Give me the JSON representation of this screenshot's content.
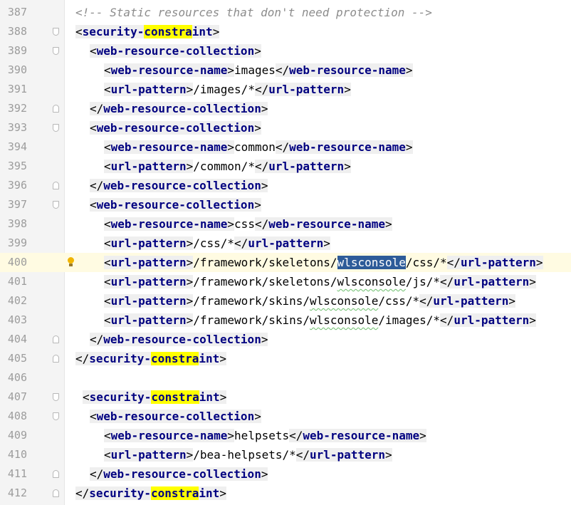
{
  "editor": {
    "lines": [
      {
        "n": "387",
        "ind": 0,
        "parts": [
          {
            "t": "<!-- Static resources that don't need protection -->",
            "c": "comment"
          }
        ]
      },
      {
        "n": "388",
        "ind": 0,
        "fold": "start",
        "parts": [
          {
            "t": "<",
            "c": "b"
          },
          {
            "t": "security-",
            "c": "tag"
          },
          {
            "t": "constra",
            "c": "taghl"
          },
          {
            "t": "int",
            "c": "tag"
          },
          {
            "t": ">",
            "c": "b"
          }
        ]
      },
      {
        "n": "389",
        "ind": 2,
        "fold": "start",
        "parts": [
          {
            "t": "<",
            "c": "b"
          },
          {
            "t": "web-resource-collection",
            "c": "tag"
          },
          {
            "t": ">",
            "c": "b"
          }
        ]
      },
      {
        "n": "390",
        "ind": 4,
        "parts": [
          {
            "t": "<",
            "c": "b"
          },
          {
            "t": "web-resource-name",
            "c": "tag"
          },
          {
            "t": ">",
            "c": "b"
          },
          {
            "t": "images",
            "c": "txt"
          },
          {
            "t": "</",
            "c": "b"
          },
          {
            "t": "web-resource-name",
            "c": "tag"
          },
          {
            "t": ">",
            "c": "b"
          }
        ]
      },
      {
        "n": "391",
        "ind": 4,
        "parts": [
          {
            "t": "<",
            "c": "b"
          },
          {
            "t": "url-pattern",
            "c": "tag"
          },
          {
            "t": ">",
            "c": "b"
          },
          {
            "t": "/images/*",
            "c": "txt"
          },
          {
            "t": "</",
            "c": "b"
          },
          {
            "t": "url-pattern",
            "c": "tag"
          },
          {
            "t": ">",
            "c": "b"
          }
        ]
      },
      {
        "n": "392",
        "ind": 2,
        "fold": "end",
        "parts": [
          {
            "t": "</",
            "c": "b"
          },
          {
            "t": "web-resource-collection",
            "c": "tag"
          },
          {
            "t": ">",
            "c": "b"
          }
        ]
      },
      {
        "n": "393",
        "ind": 2,
        "fold": "start",
        "parts": [
          {
            "t": "<",
            "c": "b"
          },
          {
            "t": "web-resource-collection",
            "c": "tag"
          },
          {
            "t": ">",
            "c": "b"
          }
        ]
      },
      {
        "n": "394",
        "ind": 4,
        "parts": [
          {
            "t": "<",
            "c": "b"
          },
          {
            "t": "web-resource-name",
            "c": "tag"
          },
          {
            "t": ">",
            "c": "b"
          },
          {
            "t": "common",
            "c": "txt"
          },
          {
            "t": "</",
            "c": "b"
          },
          {
            "t": "web-resource-name",
            "c": "tag"
          },
          {
            "t": ">",
            "c": "b"
          }
        ]
      },
      {
        "n": "395",
        "ind": 4,
        "parts": [
          {
            "t": "<",
            "c": "b"
          },
          {
            "t": "url-pattern",
            "c": "tag"
          },
          {
            "t": ">",
            "c": "b"
          },
          {
            "t": "/common/*",
            "c": "txt"
          },
          {
            "t": "</",
            "c": "b"
          },
          {
            "t": "url-pattern",
            "c": "tag"
          },
          {
            "t": ">",
            "c": "b"
          }
        ]
      },
      {
        "n": "396",
        "ind": 2,
        "fold": "end",
        "parts": [
          {
            "t": "</",
            "c": "b"
          },
          {
            "t": "web-resource-collection",
            "c": "tag"
          },
          {
            "t": ">",
            "c": "b"
          }
        ]
      },
      {
        "n": "397",
        "ind": 2,
        "fold": "start",
        "parts": [
          {
            "t": "<",
            "c": "b"
          },
          {
            "t": "web-resource-collection",
            "c": "tag"
          },
          {
            "t": ">",
            "c": "b"
          }
        ]
      },
      {
        "n": "398",
        "ind": 4,
        "parts": [
          {
            "t": "<",
            "c": "b"
          },
          {
            "t": "web-resource-name",
            "c": "tag"
          },
          {
            "t": ">",
            "c": "b"
          },
          {
            "t": "css",
            "c": "txt"
          },
          {
            "t": "</",
            "c": "b"
          },
          {
            "t": "web-resource-name",
            "c": "tag"
          },
          {
            "t": ">",
            "c": "b"
          }
        ]
      },
      {
        "n": "399",
        "ind": 4,
        "parts": [
          {
            "t": "<",
            "c": "b"
          },
          {
            "t": "url-pattern",
            "c": "tag"
          },
          {
            "t": ">",
            "c": "b"
          },
          {
            "t": "/css/*",
            "c": "txt"
          },
          {
            "t": "</",
            "c": "b"
          },
          {
            "t": "url-pattern",
            "c": "tag"
          },
          {
            "t": ">",
            "c": "b"
          }
        ]
      },
      {
        "n": "400",
        "ind": 4,
        "current": true,
        "bulb": true,
        "parts": [
          {
            "t": "<",
            "c": "b"
          },
          {
            "t": "url-pattern",
            "c": "tag"
          },
          {
            "t": ">",
            "c": "b"
          },
          {
            "t": "/framework/skeletons/",
            "c": "txt"
          },
          {
            "t": "wlsconsole",
            "c": "sel"
          },
          {
            "t": "/css/*",
            "c": "txt"
          },
          {
            "t": "</",
            "c": "b"
          },
          {
            "t": "url-pattern",
            "c": "tag"
          },
          {
            "t": ">",
            "c": "b"
          }
        ]
      },
      {
        "n": "401",
        "ind": 4,
        "parts": [
          {
            "t": "<",
            "c": "b"
          },
          {
            "t": "url-pattern",
            "c": "tag"
          },
          {
            "t": ">",
            "c": "b"
          },
          {
            "t": "/framework/skeletons/",
            "c": "txt"
          },
          {
            "t": "wlsconsole",
            "c": "sq"
          },
          {
            "t": "/js/*",
            "c": "txt"
          },
          {
            "t": "</",
            "c": "b"
          },
          {
            "t": "url-pattern",
            "c": "tag"
          },
          {
            "t": ">",
            "c": "b"
          }
        ]
      },
      {
        "n": "402",
        "ind": 4,
        "parts": [
          {
            "t": "<",
            "c": "b"
          },
          {
            "t": "url-pattern",
            "c": "tag"
          },
          {
            "t": ">",
            "c": "b"
          },
          {
            "t": "/framework/skins/",
            "c": "txt"
          },
          {
            "t": "wlsconsole",
            "c": "sq"
          },
          {
            "t": "/css/*",
            "c": "txt"
          },
          {
            "t": "</",
            "c": "b"
          },
          {
            "t": "url-pattern",
            "c": "tag"
          },
          {
            "t": ">",
            "c": "b"
          }
        ]
      },
      {
        "n": "403",
        "ind": 4,
        "parts": [
          {
            "t": "<",
            "c": "b"
          },
          {
            "t": "url-pattern",
            "c": "tag"
          },
          {
            "t": ">",
            "c": "b"
          },
          {
            "t": "/framework/skins/",
            "c": "txt"
          },
          {
            "t": "wlsconsole",
            "c": "sq"
          },
          {
            "t": "/images/*",
            "c": "txt"
          },
          {
            "t": "</",
            "c": "b"
          },
          {
            "t": "url-pattern",
            "c": "tag"
          },
          {
            "t": ">",
            "c": "b"
          }
        ]
      },
      {
        "n": "404",
        "ind": 2,
        "fold": "end",
        "parts": [
          {
            "t": "</",
            "c": "b"
          },
          {
            "t": "web-resource-collection",
            "c": "tag"
          },
          {
            "t": ">",
            "c": "b"
          }
        ]
      },
      {
        "n": "405",
        "ind": 0,
        "fold": "end",
        "parts": [
          {
            "t": "</",
            "c": "b"
          },
          {
            "t": "security-",
            "c": "tag"
          },
          {
            "t": "constra",
            "c": "taghl"
          },
          {
            "t": "int",
            "c": "tag"
          },
          {
            "t": ">",
            "c": "b"
          }
        ]
      },
      {
        "n": "406",
        "ind": 0,
        "parts": []
      },
      {
        "n": "407",
        "ind": 1,
        "fold": "start",
        "parts": [
          {
            "t": "<",
            "c": "b"
          },
          {
            "t": "security-",
            "c": "tag"
          },
          {
            "t": "constra",
            "c": "taghl"
          },
          {
            "t": "int",
            "c": "tag"
          },
          {
            "t": ">",
            "c": "b"
          }
        ]
      },
      {
        "n": "408",
        "ind": 2,
        "fold": "start",
        "parts": [
          {
            "t": "<",
            "c": "b"
          },
          {
            "t": "web-resource-collection",
            "c": "tag"
          },
          {
            "t": ">",
            "c": "b"
          }
        ]
      },
      {
        "n": "409",
        "ind": 4,
        "parts": [
          {
            "t": "<",
            "c": "b"
          },
          {
            "t": "web-resource-name",
            "c": "tag"
          },
          {
            "t": ">",
            "c": "b"
          },
          {
            "t": "helpsets",
            "c": "txt"
          },
          {
            "t": "</",
            "c": "b"
          },
          {
            "t": "web-resource-name",
            "c": "tag"
          },
          {
            "t": ">",
            "c": "b"
          }
        ]
      },
      {
        "n": "410",
        "ind": 4,
        "parts": [
          {
            "t": "<",
            "c": "b"
          },
          {
            "t": "url-pattern",
            "c": "tag"
          },
          {
            "t": ">",
            "c": "b"
          },
          {
            "t": "/bea-helpsets/*",
            "c": "txt"
          },
          {
            "t": "</",
            "c": "b"
          },
          {
            "t": "url-pattern",
            "c": "tag"
          },
          {
            "t": ">",
            "c": "b"
          }
        ]
      },
      {
        "n": "411",
        "ind": 2,
        "fold": "end",
        "parts": [
          {
            "t": "</",
            "c": "b"
          },
          {
            "t": "web-resource-collection",
            "c": "tag"
          },
          {
            "t": ">",
            "c": "b"
          }
        ]
      },
      {
        "n": "412",
        "ind": 0,
        "fold": "end",
        "parts": [
          {
            "t": "</",
            "c": "b"
          },
          {
            "t": "security-",
            "c": "tag"
          },
          {
            "t": "constra",
            "c": "taghl"
          },
          {
            "t": "int",
            "c": "tag"
          },
          {
            "t": ">",
            "c": "b"
          }
        ]
      }
    ]
  },
  "icons": {
    "fold_start": "fold-open-icon",
    "fold_end": "fold-close-icon",
    "intention": "lightbulb-icon"
  },
  "colors": {
    "tag": "#000080",
    "comment": "#8c8c8c",
    "highlight": "#ffff00",
    "selection": "#2d5b99",
    "current_line": "#fffbe2",
    "gutter": "#f4f4f4"
  }
}
